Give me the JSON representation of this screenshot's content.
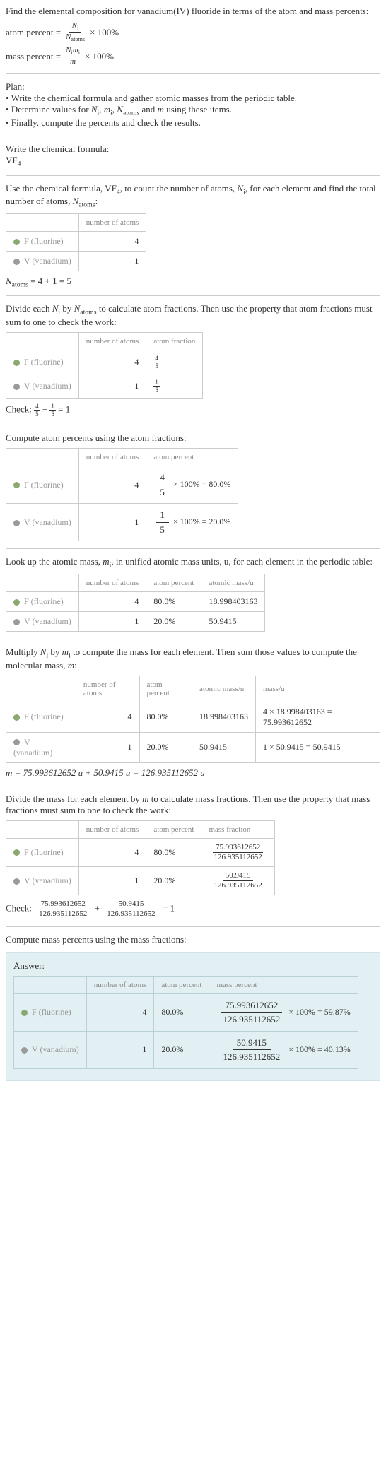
{
  "intro": {
    "line1": "Find the elemental composition for vanadium(IV) fluoride in terms of the atom and mass percents:",
    "atom_percent_lhs": "atom percent =",
    "ap_num": "N",
    "ap_num_sub": "i",
    "ap_den": "N",
    "ap_den_sub": "atoms",
    "times100": "× 100%",
    "mass_percent_lhs": "mass percent =",
    "mp_num": "N",
    "mp_num_sub_i": "i",
    "mp_num_m": "m",
    "mp_num_sub_i2": "i",
    "mp_den": "m"
  },
  "plan": {
    "title": "Plan:",
    "b1": "• Write the chemical formula and gather atomic masses from the periodic table.",
    "b2_pre": "• Determine values for ",
    "b2_vars": "N",
    "b2_i": "i",
    "b2_comma1": ", ",
    "b2_m": "m",
    "b2_i2": "i",
    "b2_comma2": ", ",
    "b2_N": "N",
    "b2_atoms": "atoms",
    "b2_and": " and ",
    "b2_mvar": "m",
    "b2_post": " using these items.",
    "b3": "• Finally, compute the percents and check the results."
  },
  "formula": {
    "title": "Write the chemical formula:",
    "vf4": "VF",
    "sub4": "4"
  },
  "count": {
    "text_pre": "Use the chemical formula, VF",
    "sub4": "4",
    "text_mid": ", to count the number of atoms, ",
    "N_i": "N",
    "i_sub": "i",
    "text_mid2": ", for each element and find the total number of atoms, ",
    "N_atoms": "N",
    "atoms_sub": "atoms",
    "colon": ":",
    "th_num": "number of atoms",
    "f_label": "F (fluorine)",
    "v_label": "V (vanadium)",
    "f_count": "4",
    "v_count": "1",
    "total_eq": "N",
    "total_sub": "atoms",
    "total_expr": " = 4 + 1 = 5"
  },
  "fractions1": {
    "text": "Divide each ",
    "N_i": "N",
    "i": "i",
    "by": " by ",
    "N_atoms": "N",
    "atoms": "atoms",
    "rest": " to calculate atom fractions. Then use the property that atom fractions must sum to one to check the work:",
    "th_num": "number of atoms",
    "th_frac": "atom fraction",
    "f_count": "4",
    "v_count": "1",
    "f_n": "4",
    "f_d": "5",
    "v_n": "1",
    "v_d": "5",
    "check_pre": "Check: ",
    "check_expr": " = 1"
  },
  "percents1": {
    "text": "Compute atom percents using the atom fractions:",
    "th_num": "number of atoms",
    "th_pct": "atom percent",
    "f_count": "4",
    "v_count": "1",
    "f_n": "4",
    "f_d": "5",
    "f_res": " × 100% = 80.0%",
    "v_n": "1",
    "v_d": "5",
    "v_res": " × 100% = 20.0%"
  },
  "lookup": {
    "text_pre": "Look up the atomic mass, ",
    "m_i": "m",
    "i": "i",
    "text_post": ", in unified atomic mass units, u, for each element in the periodic table:",
    "th_num": "number of atoms",
    "th_pct": "atom percent",
    "th_mass": "atomic mass/u",
    "f_count": "4",
    "f_pct": "80.0%",
    "f_mass": "18.998403163",
    "v_count": "1",
    "v_pct": "20.0%",
    "v_mass": "50.9415"
  },
  "multiply": {
    "text_pre": "Multiply ",
    "N_i": "N",
    "i1": "i",
    "by": " by ",
    "m_i": "m",
    "i2": "i",
    "text_mid": " to compute the mass for each element. Then sum those values to compute the molecular mass, ",
    "m": "m",
    "colon": ":",
    "th_num": "number of atoms",
    "th_pct": "atom percent",
    "th_amass": "atomic mass/u",
    "th_mass": "mass/u",
    "f_count": "4",
    "f_pct": "80.0%",
    "f_amass": "18.998403163",
    "f_calc": "4 × 18.998403163 = 75.993612652",
    "v_count": "1",
    "v_pct": "20.0%",
    "v_amass": "50.9415",
    "v_calc": "1 × 50.9415 = 50.9415",
    "total": "m = 75.993612652 u + 50.9415 u = 126.935112652 u"
  },
  "massfrac": {
    "text_pre": "Divide the mass for each element by ",
    "m": "m",
    "text_post": " to calculate mass fractions. Then use the property that mass fractions must sum to one to check the work:",
    "th_num": "number of atoms",
    "th_pct": "atom percent",
    "th_mf": "mass fraction",
    "f_count": "4",
    "f_pct": "80.0%",
    "f_n": "75.993612652",
    "f_d": "126.935112652",
    "v_count": "1",
    "v_pct": "20.0%",
    "v_n": "50.9415",
    "v_d": "126.935112652",
    "check_pre": "Check: ",
    "check_expr": " = 1"
  },
  "final": {
    "text": "Compute mass percents using the mass fractions:",
    "answer": "Answer:",
    "th_num": "number of atoms",
    "th_pct": "atom percent",
    "th_mp": "mass percent",
    "f_count": "4",
    "f_pct": "80.0%",
    "f_n": "75.993612652",
    "f_d": "126.935112652",
    "f_res": "× 100% = 59.87%",
    "v_count": "1",
    "v_pct": "20.0%",
    "v_n": "50.9415",
    "v_d": "126.935112652",
    "v_res": "× 100% = 40.13%"
  },
  "labels": {
    "f": "F (fluorine)",
    "v": "V (vanadium)"
  }
}
